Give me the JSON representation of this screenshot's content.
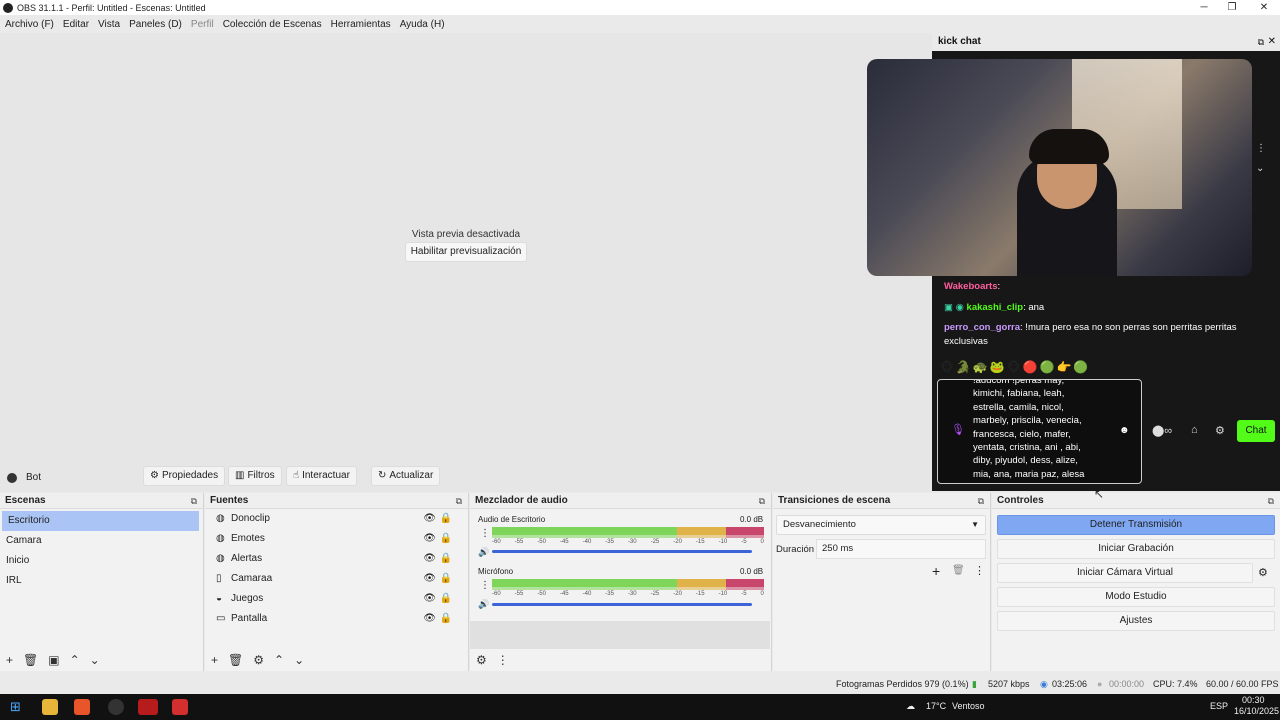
{
  "window": {
    "title": "OBS 31.1.1 - Perfil: Untitled - Escenas: Untitled",
    "minimize": "─",
    "maximize": "❐",
    "close": "✕"
  },
  "menu": [
    "Archivo (F)",
    "Editar",
    "Vista",
    "Paneles (D)",
    "Perfil",
    "Colección de Escenas",
    "Herramientas",
    "Ayuda (H)"
  ],
  "preview": {
    "disabled_text": "Vista previa desactivada",
    "enable_button": "Habilitar previsualización"
  },
  "source_toolbar": {
    "source_name": "Bot",
    "properties": "Propiedades",
    "filters": "Filtros",
    "interact": "Interactuar",
    "refresh": "Actualizar"
  },
  "scenes": {
    "title": "Escenas",
    "items": [
      "Escritorio",
      "Camara",
      "Inicio",
      "IRL"
    ],
    "selected": "Escritorio"
  },
  "sources": {
    "title": "Fuentes",
    "items": [
      {
        "name": "Donoclip",
        "icon": "globe-icon"
      },
      {
        "name": "Emotes",
        "icon": "globe-icon"
      },
      {
        "name": "Alertas",
        "icon": "globe-icon"
      },
      {
        "name": "Camaraa",
        "icon": "file-icon"
      },
      {
        "name": "Juegos",
        "icon": "gamepad-icon"
      },
      {
        "name": "Pantalla",
        "icon": "monitor-icon"
      }
    ]
  },
  "mixer": {
    "title": "Mezclador de audio",
    "channels": [
      {
        "name": "Audio de Escritorio",
        "level": "0.0 dB"
      },
      {
        "name": "Micrófono",
        "level": "0.0 dB"
      }
    ],
    "scale": [
      "-60",
      "-55",
      "-50",
      "-45",
      "-40",
      "-35",
      "-30",
      "-25",
      "-20",
      "-15",
      "-10",
      "-5",
      "0"
    ]
  },
  "transitions": {
    "title": "Transiciones de escena",
    "selected": "Desvanecimiento",
    "duration_label": "Duración",
    "duration_value": "250 ms"
  },
  "controls": {
    "title": "Controles",
    "buttons": [
      "Detener Transmisión",
      "Iniciar Grabación",
      "Iniciar Cámara Virtual",
      "Modo Estudio",
      "Ajustes"
    ]
  },
  "status": {
    "dropped": "Fotogramas Perdidos 979 (0.1%)",
    "bitrate": "5207 kbps",
    "stream_time": "03:25:06",
    "rec_time": "00:00:00",
    "cpu": "CPU: 7.4%",
    "fps": "60.00 / 60.00 FPS"
  },
  "chat": {
    "title": "kick chat",
    "messages": [
      {
        "user": "Wakeboarts",
        "color": "#ff5f9f",
        "text": ""
      },
      {
        "user": "kakashi_clip",
        "color": "#53fc18",
        "text": ": ana"
      },
      {
        "user": "perro_con_gorra",
        "color": "#c89bff",
        "text": ": !mura pero esa no son perras son perritas perritas exclusivas"
      }
    ],
    "input_text": "!addcom !perras may, kimichi, fabiana, leah, estrella, camila, nicol, marbely, priscila, venecia, francesca, cielo, mafer, yentata, cristina, ani , abi, diby, piyudol, dess, alize, mia, ana, maria paz, alesa",
    "send_label": "Chat"
  },
  "taskbar": {
    "temp": "17°C",
    "weather": "Ventoso",
    "lang": "ESP",
    "time": "00:30",
    "date": "16/10/2025"
  }
}
